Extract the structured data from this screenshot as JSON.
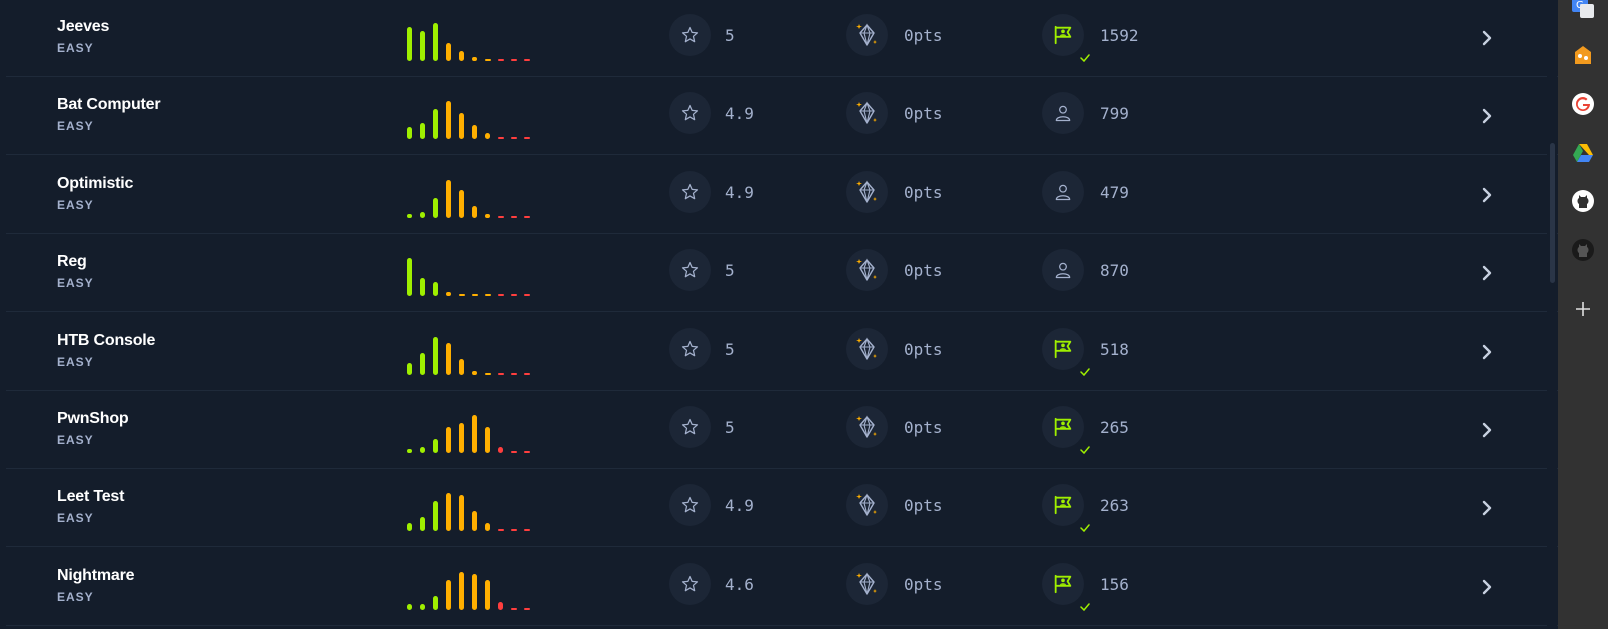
{
  "rows": [
    {
      "name": "Jeeves",
      "difficulty": "EASY",
      "rating": "5",
      "points": "0pts",
      "solves": "1592",
      "solved": true,
      "ratings": [
        8.5,
        7.5,
        9.5,
        4.5,
        2.5,
        1,
        0,
        0,
        0,
        0
      ]
    },
    {
      "name": "Bat Computer",
      "difficulty": "EASY",
      "rating": "4.9",
      "points": "0pts",
      "solves": "799",
      "solved": false,
      "ratings": [
        3,
        4,
        7.5,
        9.5,
        6.5,
        3.5,
        1.5,
        0,
        0,
        0
      ]
    },
    {
      "name": "Optimistic",
      "difficulty": "EASY",
      "rating": "4.9",
      "points": "0pts",
      "solves": "479",
      "solved": false,
      "ratings": [
        1,
        1.5,
        5,
        9.5,
        7,
        3,
        1,
        0,
        0,
        0
      ]
    },
    {
      "name": "Reg",
      "difficulty": "EASY",
      "rating": "5",
      "points": "0pts",
      "solves": "870",
      "solved": false,
      "ratings": [
        9.5,
        4.5,
        3.5,
        0.5,
        0,
        0,
        0,
        0,
        0,
        0
      ]
    },
    {
      "name": "HTB Console",
      "difficulty": "EASY",
      "rating": "5",
      "points": "0pts",
      "solves": "518",
      "solved": true,
      "ratings": [
        3,
        5.5,
        9.5,
        8,
        4,
        1,
        0,
        0,
        0,
        0
      ]
    },
    {
      "name": "PwnShop",
      "difficulty": "EASY",
      "rating": "5",
      "points": "0pts",
      "solves": "265",
      "solved": true,
      "ratings": [
        0.5,
        1.5,
        3.5,
        6.5,
        7.5,
        9.5,
        6.5,
        1.5,
        0,
        0
      ]
    },
    {
      "name": "Leet Test",
      "difficulty": "EASY",
      "rating": "4.9",
      "points": "0pts",
      "solves": "263",
      "solved": true,
      "ratings": [
        2,
        3.5,
        7.5,
        9.5,
        9,
        5,
        2,
        0,
        0,
        0
      ]
    },
    {
      "name": "Nightmare",
      "difficulty": "EASY",
      "rating": "4.6",
      "points": "0pts",
      "solves": "156",
      "solved": true,
      "ratings": [
        1.5,
        1.5,
        3.5,
        7.5,
        9.5,
        9,
        7.5,
        2,
        0,
        0
      ]
    }
  ],
  "colors": {
    "bars": [
      "#9fef00",
      "#9fef00",
      "#9fef00",
      "#ffaf00",
      "#ffaf00",
      "#ffaf00",
      "#ffaf00",
      "#ff3e3e",
      "#ff3e3e",
      "#ff3e3e"
    ],
    "accent": "#9fef00",
    "muted": "#a4b1cd",
    "background": "#141d2b"
  },
  "icons": {
    "rating": "star-icon",
    "points": "crystal-icon",
    "solved": "flag-user-icon",
    "unsolved": "user-icon",
    "open": "chevron-right-icon"
  },
  "sidebar": [
    "google-translate-icon",
    "extension-icon",
    "google-icon",
    "google-drive-icon",
    "github-icon",
    "github-dark-icon",
    "add-icon"
  ]
}
